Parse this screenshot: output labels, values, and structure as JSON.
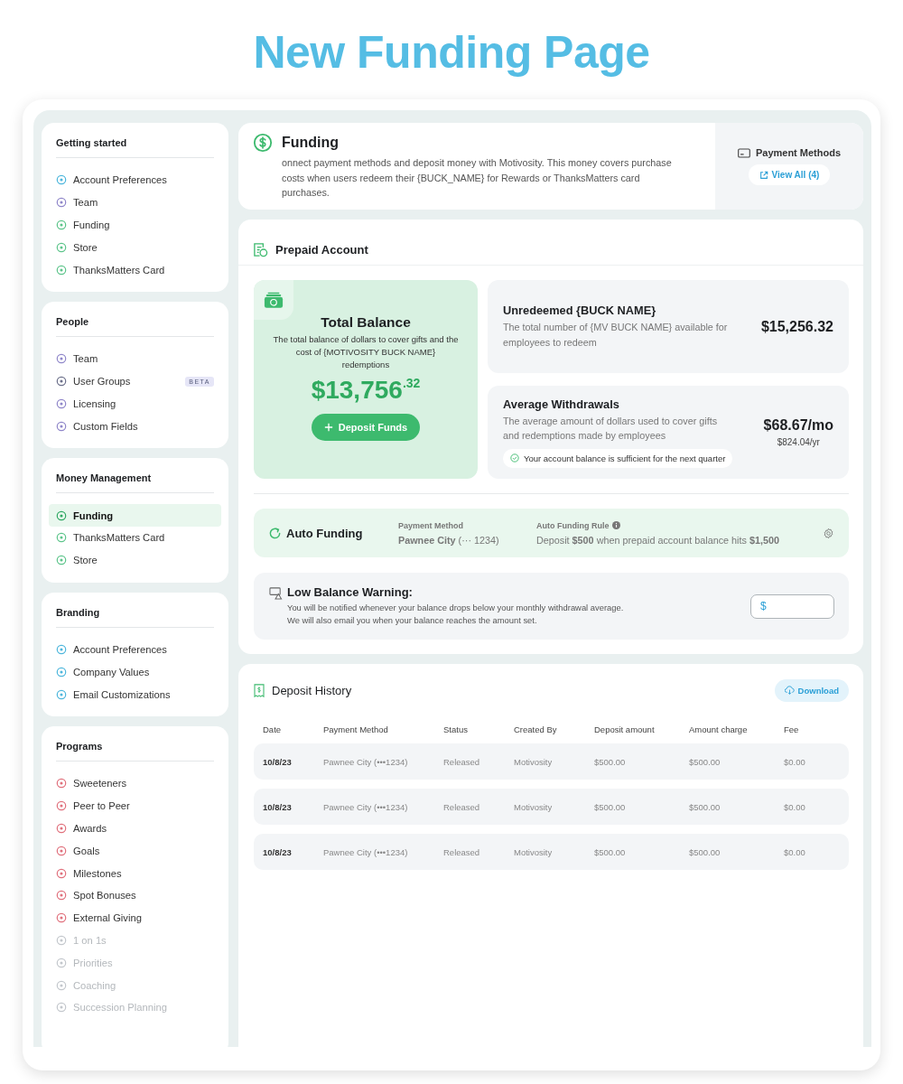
{
  "page_title": "New Funding Page",
  "sidebar": {
    "sections": [
      {
        "title": "Getting started",
        "items": [
          {
            "label": "Account Preferences",
            "color": "#4db6dc",
            "selected": false,
            "disabled": false
          },
          {
            "label": "Team",
            "color": "#8f86c9",
            "selected": false,
            "disabled": false
          },
          {
            "label": "Funding",
            "color": "#5cc48a",
            "selected": false,
            "disabled": false
          },
          {
            "label": "Store",
            "color": "#5cc48a",
            "selected": false,
            "disabled": false
          },
          {
            "label": "ThanksMatters Card",
            "color": "#5cc48a",
            "selected": false,
            "disabled": false
          }
        ]
      },
      {
        "title": "People",
        "items": [
          {
            "label": "Team",
            "color": "#8f86c9",
            "selected": false,
            "disabled": false
          },
          {
            "label": "User Groups",
            "color": "#6b6f8a",
            "selected": false,
            "disabled": false,
            "badge": "BETA"
          },
          {
            "label": "Licensing",
            "color": "#8f86c9",
            "selected": false,
            "disabled": false
          },
          {
            "label": "Custom Fields",
            "color": "#8f86c9",
            "selected": false,
            "disabled": false
          }
        ]
      },
      {
        "title": "Money Management",
        "items": [
          {
            "label": "Funding",
            "color": "#2fa862",
            "selected": true,
            "disabled": false
          },
          {
            "label": "ThanksMatters Card",
            "color": "#5cc48a",
            "selected": false,
            "disabled": false
          },
          {
            "label": "Store",
            "color": "#5cc48a",
            "selected": false,
            "disabled": false
          }
        ]
      },
      {
        "title": "Branding",
        "items": [
          {
            "label": "Account Preferences",
            "color": "#4db6dc",
            "selected": false,
            "disabled": false
          },
          {
            "label": "Company Values",
            "color": "#4db6dc",
            "selected": false,
            "disabled": false
          },
          {
            "label": "Email Customizations",
            "color": "#4db6dc",
            "selected": false,
            "disabled": false
          }
        ]
      },
      {
        "title": "Programs",
        "items": [
          {
            "label": "Sweeteners",
            "color": "#e0707c",
            "selected": false,
            "disabled": false
          },
          {
            "label": "Peer to Peer",
            "color": "#e0707c",
            "selected": false,
            "disabled": false
          },
          {
            "label": "Awards",
            "color": "#e0707c",
            "selected": false,
            "disabled": false
          },
          {
            "label": "Goals",
            "color": "#e0707c",
            "selected": false,
            "disabled": false
          },
          {
            "label": "Milestones",
            "color": "#e0707c",
            "selected": false,
            "disabled": false
          },
          {
            "label": "Spot Bonuses",
            "color": "#e0707c",
            "selected": false,
            "disabled": false
          },
          {
            "label": "External Giving",
            "color": "#e0707c",
            "selected": false,
            "disabled": false
          },
          {
            "label": "1 on 1s",
            "color": "#c3c7cc",
            "selected": false,
            "disabled": true
          },
          {
            "label": "Priorities",
            "color": "#c3c7cc",
            "selected": false,
            "disabled": true
          },
          {
            "label": "Coaching",
            "color": "#c3c7cc",
            "selected": false,
            "disabled": true
          },
          {
            "label": "Succession Planning",
            "color": "#c3c7cc",
            "selected": false,
            "disabled": true
          }
        ]
      }
    ]
  },
  "header": {
    "title": "Funding",
    "description": "onnect payment methods and deposit money with Motivosity. This money covers purchase costs when users redeem their {BUCK_NAME} for Rewards or ThanksMatters card purchases.",
    "payment_methods": {
      "label": "Payment Methods",
      "button": "View All (4)"
    }
  },
  "prepaid": {
    "title": "Prepaid Account",
    "total": {
      "title": "Total Balance",
      "description": "The total balance of dollars to cover gifts and the cost of {MOTIVOSITY BUCK NAME} redemptions",
      "amount": "$13,756$^{.32}$",
      "button": "Deposit Funds"
    },
    "stats": [
      {
        "title": "Unredeemed {BUCK NAME}",
        "description": "The total number of {MV BUCK NAME} available for employees to redeem",
        "value": "$15,256.32"
      },
      {
        "title": "Average Withdrawals",
        "description": "The average amount of dollars used to cover gifts and redemptions made by employees",
        "value": "$68.67/mo",
        "subvalue": "$824.04/yr",
        "note": "Your account balance is sufficient for the next quarter"
      }
    ],
    "auto_funding": {
      "title": "Auto Funding",
      "method_label": "Payment Method",
      "method": "**Pawnee City** (··· 1234)",
      "rule_label": "Auto Funding Rule",
      "rule": "Deposit **$500** when prepaid account balance hits **$1,500**"
    },
    "low_balance": {
      "title": "Low Balance Warning:",
      "lines": [
        "You will be notified whenever your balance drops below your monthly withdrawal average.",
        "We will also email you when your balance reaches the amount set."
      ],
      "field": {
        "placeholder": "$"
      }
    }
  },
  "deposit_history": {
    "title": "Deposit History",
    "button": "Download",
    "columns": [
      "Date",
      "Payment Method",
      "Status",
      "Created By",
      "Deposit amount",
      "Amount charge",
      "Fee"
    ],
    "rows": [
      [
        "10/8/23",
        "Pawnee City (•••1234)",
        "Released",
        "Motivosity",
        "$500.00",
        "$500.00",
        "$0.00"
      ],
      [
        "10/8/23",
        "Pawnee City (•••1234)",
        "Released",
        "Motivosity",
        "$500.00",
        "$500.00",
        "$0.00"
      ],
      [
        "10/8/23",
        "Pawnee City (•••1234)",
        "Released",
        "Motivosity",
        "$500.00",
        "$500.00",
        "$0.00"
      ]
    ]
  }
}
